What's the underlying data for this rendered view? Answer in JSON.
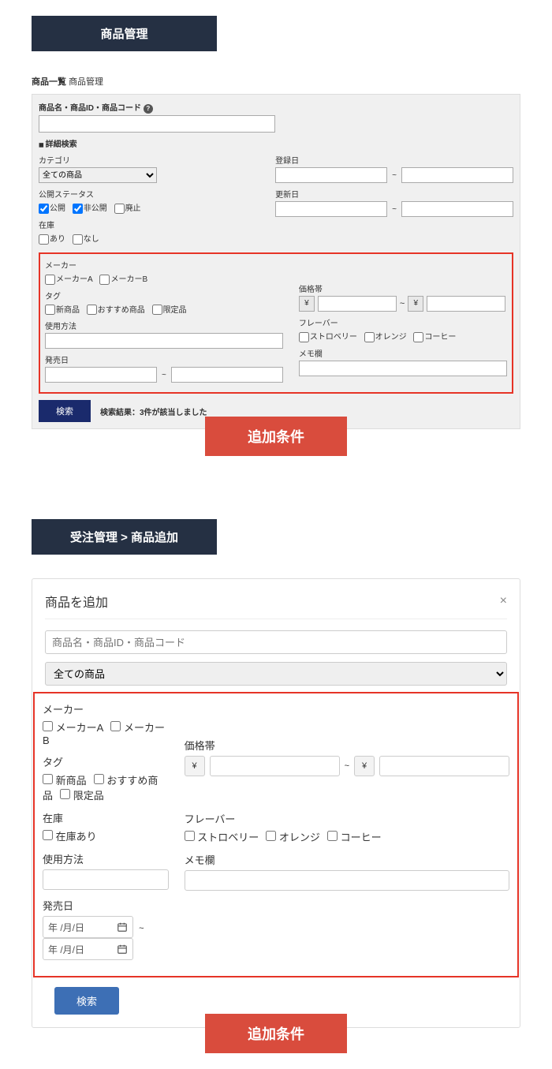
{
  "section1": {
    "header": "商品管理",
    "breadcrumb1": "商品一覧",
    "breadcrumb2": "商品管理",
    "search_label": "商品名・商品ID・商品コード",
    "detail_toggle": "詳細検索",
    "fields": {
      "category": {
        "label": "カテゴリ",
        "selected": "全ての商品"
      },
      "status": {
        "label": "公開ステータス",
        "options": [
          "公開",
          "非公開",
          "廃止"
        ]
      },
      "stock": {
        "label": "在庫",
        "options": [
          "あり",
          "なし"
        ]
      },
      "reg_date": {
        "label": "登録日",
        "tilde": "~"
      },
      "upd_date": {
        "label": "更新日",
        "tilde": "~"
      }
    },
    "extra": {
      "maker": {
        "label": "メーカー",
        "options": [
          "メーカーA",
          "メーカーB"
        ]
      },
      "tag": {
        "label": "タグ",
        "options": [
          "新商品",
          "おすすめ商品",
          "限定品"
        ]
      },
      "usage": {
        "label": "使用方法"
      },
      "release": {
        "label": "発売日",
        "tilde": "~"
      },
      "price": {
        "label": "価格帯",
        "yen": "¥",
        "tilde": "~"
      },
      "flavor": {
        "label": "フレーバー",
        "options": [
          "ストロベリー",
          "オレンジ",
          "コーヒー"
        ]
      },
      "memo": {
        "label": "メモ欄"
      }
    },
    "search_btn": "検索",
    "result_text": "検索結果：3件が該当しました",
    "callout": "追加条件"
  },
  "section2": {
    "header": "受注管理  >  商品追加",
    "modal_title": "商品を追加",
    "close": "×",
    "search_placeholder": "商品名・商品ID・商品コード",
    "category_selected": "全ての商品",
    "extra": {
      "maker": {
        "label": "メーカー",
        "options": [
          "メーカーA",
          "メーカーB"
        ]
      },
      "tag": {
        "label": "タグ",
        "options": [
          "新商品",
          "おすすめ商品",
          "限定品"
        ]
      },
      "stock": {
        "label": "在庫",
        "option": "在庫あり"
      },
      "usage": {
        "label": "使用方法"
      },
      "release": {
        "label": "発売日",
        "date_ph": "年 /月/日",
        "tilde": "~"
      },
      "price": {
        "label": "価格帯",
        "yen": "¥",
        "tilde": "~"
      },
      "flavor": {
        "label": "フレーバー",
        "options": [
          "ストロベリー",
          "オレンジ",
          "コーヒー"
        ]
      },
      "memo": {
        "label": "メモ欄"
      }
    },
    "search_btn": "検索",
    "callout": "追加条件"
  }
}
